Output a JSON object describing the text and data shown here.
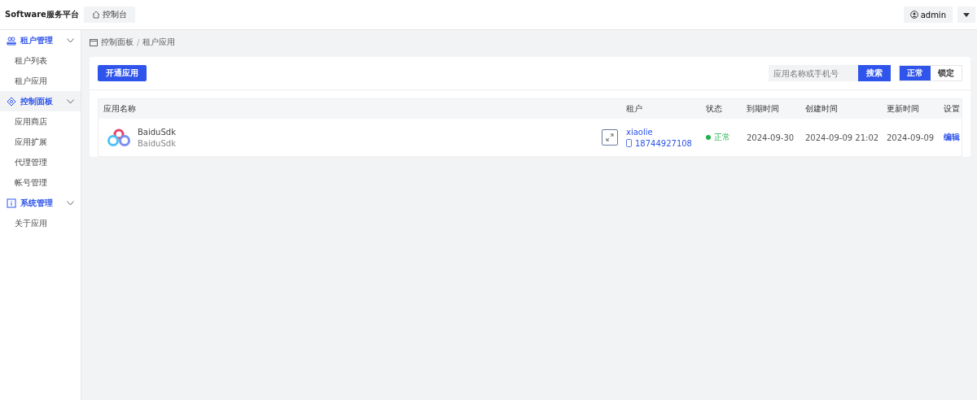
{
  "header": {
    "brand": "Software服务平台",
    "home_tab": "控制台",
    "user": "admin"
  },
  "sidebar": {
    "groups": [
      {
        "label": "租户管理",
        "selected": false,
        "expanded": true,
        "children": [
          {
            "label": "租户列表"
          },
          {
            "label": "租户应用"
          }
        ]
      },
      {
        "label": "控制面板",
        "selected": true,
        "expanded": true,
        "children": [
          {
            "label": "应用商店"
          },
          {
            "label": "应用扩展"
          },
          {
            "label": "代理管理"
          },
          {
            "label": "帐号管理"
          }
        ]
      },
      {
        "label": "系统管理",
        "selected": false,
        "expanded": true,
        "children": [
          {
            "label": "关于应用"
          }
        ]
      }
    ]
  },
  "breadcrumb": {
    "items": [
      "控制面板",
      "租户应用"
    ],
    "separator": "/"
  },
  "toolbar": {
    "create_button": "开通应用",
    "search": {
      "placeholder": "应用名称或手机号"
    },
    "search_button": "搜索",
    "status_filter": [
      {
        "label": "正常",
        "selected": true
      },
      {
        "label": "锁定",
        "selected": false
      }
    ]
  },
  "table": {
    "columns": [
      "应用名称",
      "租户",
      "状态",
      "到期时间",
      "创建时间",
      "更新时间",
      "设置"
    ],
    "rows": [
      {
        "app_name": "BaiduSdk",
        "app_subtitle": "BaiduSdk",
        "tenant": "xiaolie",
        "phone": "18744927108",
        "status": "正常",
        "expires": "2024-09-30",
        "created": "2024-09-09 21:02",
        "updated": "2024-09-09",
        "action": "编辑"
      }
    ]
  }
}
